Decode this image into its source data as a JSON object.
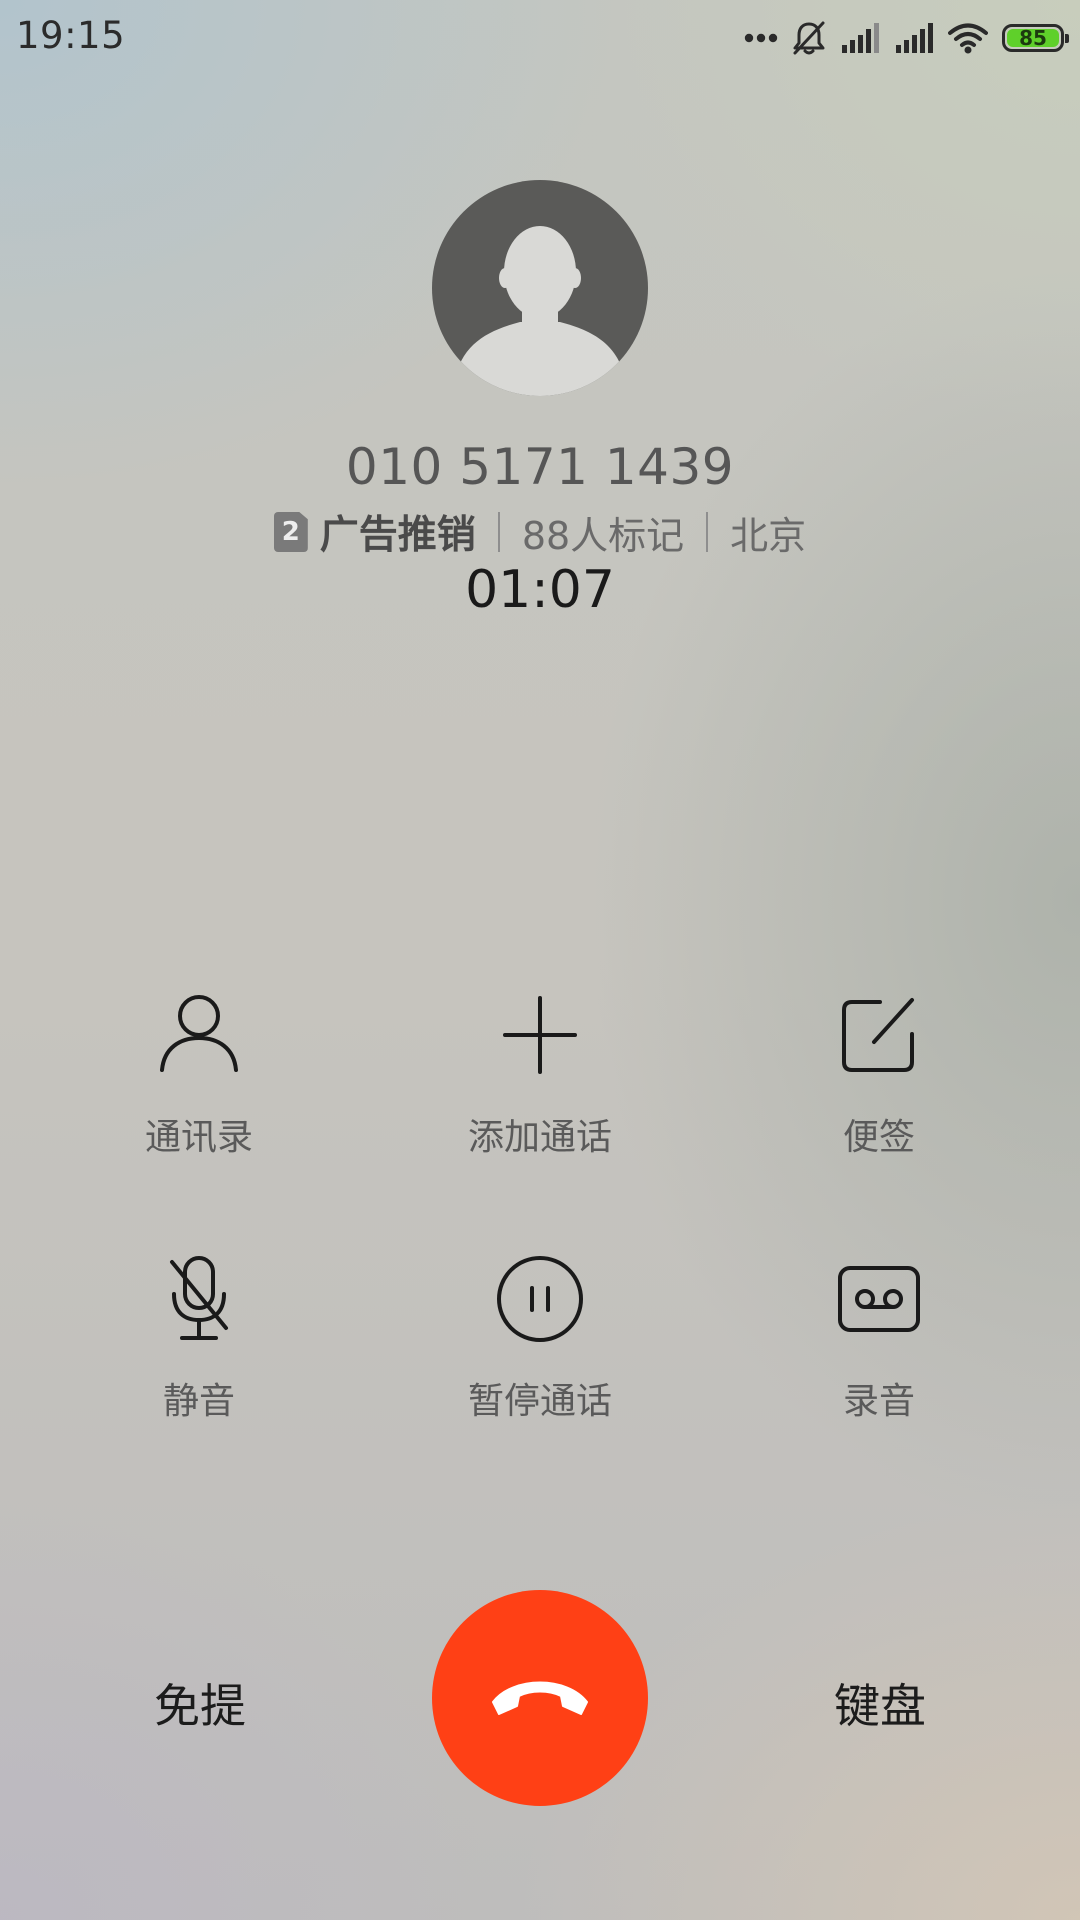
{
  "status_bar": {
    "time": "19:15",
    "battery_level": "85",
    "icons": [
      "more-dots-icon",
      "silent-bell-icon",
      "signal-sim1-icon",
      "signal-sim2-icon",
      "wifi-icon",
      "battery-icon"
    ]
  },
  "caller": {
    "avatar_icon": "person-silhouette-icon",
    "phone_number": "010 5171 1439",
    "sim_slot": "2",
    "tag": "广告推销",
    "mark_count": "88人标记",
    "location": "北京",
    "duration": "01:07"
  },
  "actions": {
    "row1": [
      {
        "label": "通讯录",
        "icon": "contact-icon"
      },
      {
        "label": "添加通话",
        "icon": "plus-icon"
      },
      {
        "label": "便签",
        "icon": "note-icon"
      }
    ],
    "row2": [
      {
        "label": "静音",
        "icon": "mic-off-icon"
      },
      {
        "label": "暂停通话",
        "icon": "pause-icon"
      },
      {
        "label": "录音",
        "icon": "record-icon"
      }
    ]
  },
  "bottom": {
    "speaker_label": "免提",
    "keypad_label": "键盘",
    "end_call_icon": "hang-up-icon"
  },
  "colors": {
    "end_call": "#ff4015",
    "battery_fill": "#5fd02a"
  }
}
